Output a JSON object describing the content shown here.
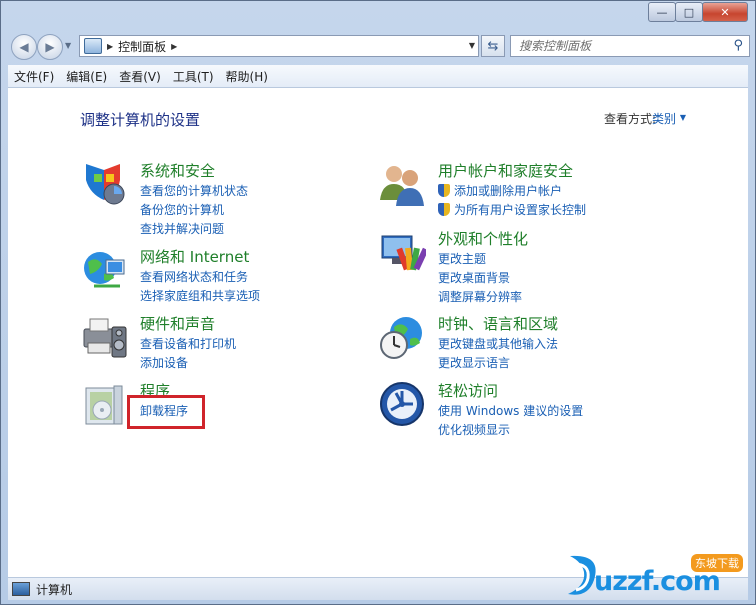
{
  "window": {
    "caption": {
      "minimize_glyph": "—",
      "maximize_glyph": "□",
      "close_glyph": "✕"
    }
  },
  "address_bar": {
    "breadcrumb": [
      "控制面板"
    ],
    "search_placeholder": "搜索控制面板"
  },
  "menu": [
    "文件(F)",
    "编辑(E)",
    "查看(V)",
    "工具(T)",
    "帮助(H)"
  ],
  "main": {
    "title": "调整计算机的设置",
    "view_by_label": "查看方式:",
    "view_by_value": "类别",
    "categories": [
      {
        "title": "系统和安全",
        "links": [
          "查看您的计算机状态",
          "备份您的计算机",
          "查找并解决问题"
        ],
        "icon": "system-security-icon"
      },
      {
        "title": "网络和 Internet",
        "links": [
          "查看网络状态和任务",
          "选择家庭组和共享选项"
        ],
        "icon": "network-icon"
      },
      {
        "title": "硬件和声音",
        "links": [
          "查看设备和打印机",
          "添加设备"
        ],
        "icon": "hardware-sound-icon"
      },
      {
        "title": "程序",
        "links": [
          "卸载程序"
        ],
        "icon": "programs-icon"
      },
      {
        "title": "用户帐户和家庭安全",
        "links": [
          "添加或删除用户帐户",
          "为所有用户设置家长控制"
        ],
        "icon": "user-accounts-icon"
      },
      {
        "title": "外观和个性化",
        "links": [
          "更改主题",
          "更改桌面背景",
          "调整屏幕分辨率"
        ],
        "icon": "appearance-icon"
      },
      {
        "title": "时钟、语言和区域",
        "links": [
          "更改键盘或其他输入法",
          "更改显示语言"
        ],
        "icon": "clock-region-icon"
      },
      {
        "title": "轻松访问",
        "links": [
          "使用 Windows 建议的设置",
          "优化视频显示"
        ],
        "icon": "ease-of-access-icon"
      }
    ]
  },
  "status_bar": {
    "text": "计算机"
  },
  "watermark": {
    "text": "uzzf.com",
    "tag": "东坡下载"
  },
  "colors": {
    "category_title": "#1f7f2a",
    "link": "#1a5fb4",
    "page_title": "#1e3287",
    "highlight": "#d0242a"
  }
}
